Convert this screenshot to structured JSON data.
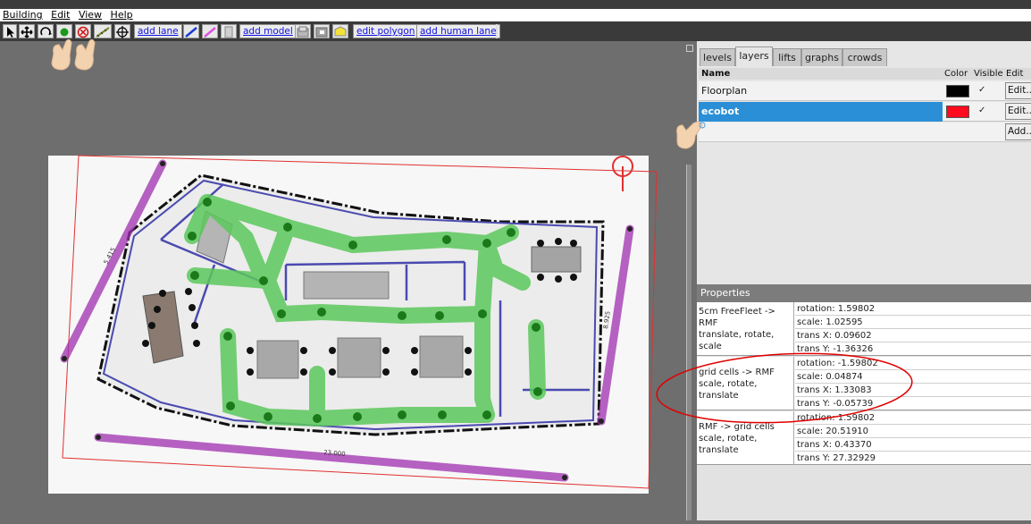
{
  "menu": {
    "building": "Building",
    "edit": "Edit",
    "view": "View",
    "help": "Help"
  },
  "toolbar": {
    "add_lane": "add lane",
    "add_model": "add model",
    "edit_polygon": "edit polygon",
    "add_human_lane": "add human lane"
  },
  "tabs": [
    "levels",
    "layers",
    "lifts",
    "graphs",
    "crowds"
  ],
  "active_tab": "layers",
  "layers": {
    "headers": {
      "name": "Name",
      "color": "Color",
      "visible": "Visible",
      "edit": "Edit"
    },
    "rows": [
      {
        "name": "Floorplan",
        "color": "#000000",
        "visible": "✓",
        "edit": "Edit..."
      },
      {
        "name": "ecobot",
        "color": "#ff0a1e",
        "visible": "✓",
        "edit": "Edit..."
      }
    ],
    "add_label": "Add..."
  },
  "properties": {
    "header": "Properties",
    "rows": [
      {
        "label_line1": "5cm FreeFleet -> RMF",
        "label_line2": "translate, rotate, scale",
        "rotation": "rotation: 1.59802",
        "scale": "scale: 1.02595",
        "trans_x": "trans X: 0.09602",
        "trans_y": "trans Y: -1.36326"
      },
      {
        "label_line1": "grid cells -> RMF",
        "label_line2": "scale, rotate, translate",
        "rotation": "rotation: -1.59802",
        "scale": "scale: 0.04874",
        "trans_x": "trans X: 1.33083",
        "trans_y": "trans Y: -0.05739"
      },
      {
        "label_line1": "RMF -> grid cells",
        "label_line2": "scale, rotate, translate",
        "rotation": "rotation: 1.59802",
        "scale": "scale: 20.51910",
        "trans_x": "trans X: 0.43370",
        "trans_y": "trans Y: 27.32929"
      }
    ]
  },
  "map": {
    "wall_label_left": "5.415",
    "wall_label_right": "8.925",
    "wall_label_bottom": "23.000"
  },
  "colors": {
    "selection_blue": "#2a8fd6",
    "lane_green": "#5cc85c",
    "measure_purple": "#b060c0",
    "annotation_red": "#e00000"
  }
}
